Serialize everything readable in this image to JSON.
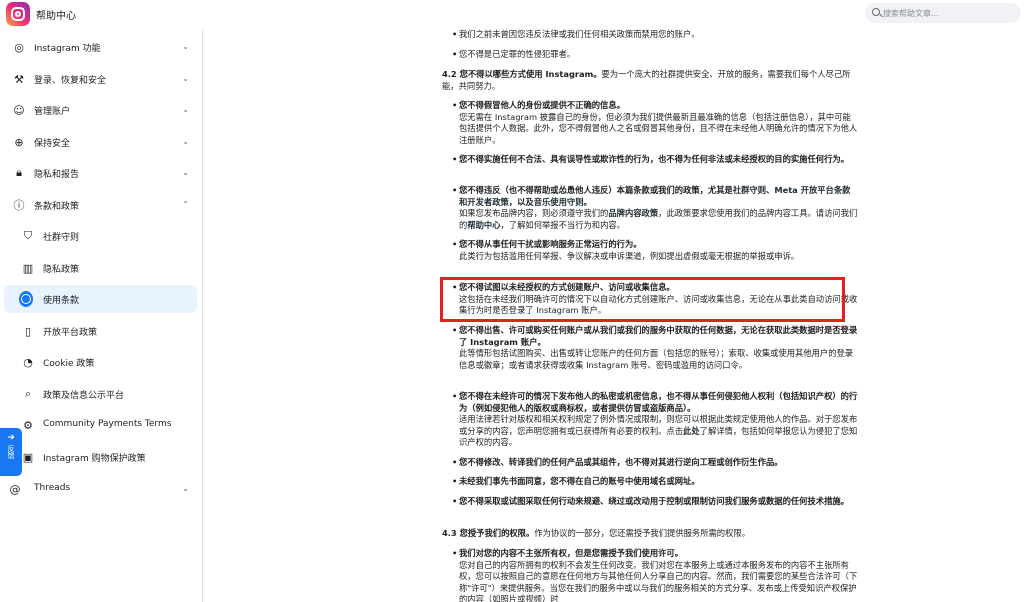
{
  "header": {
    "site_title": "帮助中心",
    "search_placeholder": "搜索帮助文章..."
  },
  "sidebar": {
    "items": [
      {
        "label": "Instagram 功能",
        "icon": "instagram-icon",
        "chevron": "⌄"
      },
      {
        "label": "登录、恢复和安全",
        "icon": "tools-icon",
        "chevron": "⌄"
      },
      {
        "label": "管理账户",
        "icon": "person-icon",
        "chevron": "⌄"
      },
      {
        "label": "保持安全",
        "icon": "lifebuoy-icon",
        "chevron": "⌄"
      },
      {
        "label": "隐私和报告",
        "icon": "lock-icon",
        "chevron": "⌄"
      },
      {
        "label": "条款和政策",
        "icon": "alert-icon",
        "chevron": "⌃"
      }
    ],
    "sub_items": [
      {
        "label": "社群守则",
        "icon": "shield-check-icon"
      },
      {
        "label": "隐私政策",
        "icon": "bar-chart-icon"
      },
      {
        "label": "使用条款",
        "icon": "terms-icon",
        "active": true
      },
      {
        "label": "开放平台政策",
        "icon": "mobile-icon"
      },
      {
        "label": "Cookie 政策",
        "icon": "cookie-icon"
      },
      {
        "label": "政策及信息公示平台",
        "icon": "magnifier-icon"
      },
      {
        "label": "Community Payments Terms",
        "icon": "payment-icon"
      },
      {
        "label": "Instagram 购物保护政策",
        "icon": "shopping-icon"
      }
    ],
    "threads": {
      "label": "Threads",
      "icon": "threads-icon",
      "chevron": "⌄"
    },
    "feedback": {
      "label": "反馈",
      "icon": "arrow-right-icon"
    }
  },
  "content": {
    "b1": "我们之前未曾因您违反法律或我们任何相关政策而禁用您的账户。",
    "b2": "您不得是已定罪的性侵犯罪者。",
    "sec42_title": "4.2 您不得以哪些方式使用 Instagram。",
    "sec42_text": "要为一个庞大的社群提供安全、开放的服务，需要我们每个人尽己所能，共同努力。",
    "i1_bold": "您不得假冒他人的身份或提供不正确的信息。",
    "i1_text": "您无需在 Instagram 披露自己的身份，但必须为我们提供最新且最准确的信息（包括注册信息），其中可能包括提供个人数据。此外，您不得假冒他人之名或假冒其他身份，且不得在未经他人明确允许的情况下为他人注册账户。",
    "i2_bold": "您不得实施任何不合法、具有误导性或欺诈性的行为，也不得为任何非法或未经授权的目的实施任何行为。",
    "i3_bold_a": "您不得违反（也不得帮助或怂恿他人违反）本篇条款或我们的政策，尤其是",
    "i3_link1": "社群守则",
    "i3_sep1": "、",
    "i3_link2": "Meta 开放平台条款和开发者政策",
    "i3_sep2": "，以及",
    "i3_link3": "音乐使用守则",
    "i3_end": "。",
    "i3_text_a": "如果您发布品牌内容，则必须遵守我们的",
    "i3_link4": "品牌内容政策",
    "i3_text_b": "，此政策要求您使用我们的品牌内容工具。请访问我们的",
    "i3_link5": "帮助中心",
    "i3_text_c": "，了解如何举报不当行为和内容。",
    "i4_bold": "您不得从事任何干扰或影响服务正常运行的行为。",
    "i4_text": "此类行为包括滥用任何举报、争议解决或申诉渠道，例如提出虚假或毫无根据的举报或申诉。",
    "i5_bold": "您不得试图以未经授权的方式创建账户、访问或收集信息。",
    "i5_text": "这包括在未经我们明确许可的情况下以自动化方式创建账户、访问或收集信息，无论在从事此类自动访问或收集行为时是否登录了 Instagram 账户。",
    "i6_bold": "您不得出售、许可或购买任何账户或从我们或我们的服务中获取的任何数据，无论在获取此类数据时是否登录了 Instagram 账户。",
    "i6_text": "此等情形包括试图购买、出售或转让您账户的任何方面（包括您的账号）；索取、收集或使用其他用户的登录信息或徽章；或者请求获得或收集 Instagram 账号、密码或滥用的访问口令。",
    "i7_bold": "您不得在未经许可的情况下发布他人的私密或机密信息，也不得从事任何侵犯他人权利（包括知识产权）的行为（例如侵犯他人的版权或商标权，或者提供仿冒或盗版商品）。",
    "i7_text_a": "适用法律若针对版权和相关权利规定了例外情况或限制，则您可以根据此类规定使用他人的作品。对于您发布或分享的内容，您声明您拥有或已获得所有必要的权利。点击",
    "i7_link": "此处",
    "i7_text_b": "了解详情，包括如何举报您认为侵犯了您知识产权的内容。",
    "i8_bold": "您不得修改、转译我们的任何产品或其组件，也不得对其进行逆向工程或创作衍生作品。",
    "i9_bold": "未经我们事先书面同意，您不得在自己的账号中使用域名或网址。",
    "i10_bold": "您不得采取或试图采取任何行动来规避、绕过或改动用于控制或限制访问我们服务或数据的任何技术措施。",
    "sec43_title": "4.3 您授予我们的权限。",
    "sec43_text": "作为协议的一部分，您还需授予我们提供服务所需的权限。",
    "i11_bold": "我们对您的内容不主张所有权，但是您需授予我们使用许可。",
    "i11_text": "您对自己的内容所拥有的权利不会发生任何改变。我们对您在本服务上或通过本服务发布的内容不主张所有权，您可以按照自己的意愿在任何地方与其他任何人分享自己的内容。然而，我们需要您的某些合法许可（下称\"许可\"）来提供服务。当您在我们的服务中或以与我们的服务相关的方式分享、发布或上传受知识产权保护的内容（如照片或视频）时"
  },
  "colors": {
    "accent": "#1877f2",
    "highlight_border": "#e0231b",
    "active_bg": "#e7f3ff"
  }
}
